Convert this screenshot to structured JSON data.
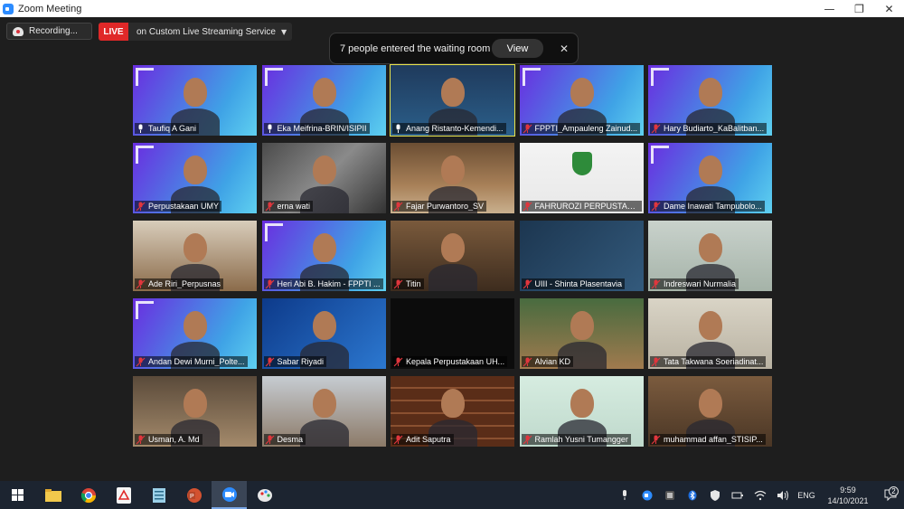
{
  "window": {
    "title": "Zoom Meeting"
  },
  "toolbar": {
    "recording_label": "Recording...",
    "live_badge": "LIVE",
    "live_service": "on Custom Live Streaming Service"
  },
  "waiting_room": {
    "message": "7 people entered the waiting room",
    "view_label": "View"
  },
  "participants": [
    {
      "name": "Taufiq  A Gani",
      "muted": false,
      "bg": "semi"
    },
    {
      "name": "Eka Meifrina-BRIN/ISIPII",
      "muted": false,
      "bg": "semi"
    },
    {
      "name": "Anang Ristanto-Kemendi...",
      "muted": false,
      "bg": "slide",
      "active": true
    },
    {
      "name": "FPPTI_Ampauleng Zainud...",
      "muted": true,
      "bg": "semi"
    },
    {
      "name": "Hary Budiarto_KaBalitban...",
      "muted": true,
      "bg": "semi"
    },
    {
      "name": "Perpustakaan UMY",
      "muted": true,
      "bg": "semi"
    },
    {
      "name": "erna wati",
      "muted": true,
      "bg": "room"
    },
    {
      "name": "Fajar Purwantoro_SV",
      "muted": true,
      "bg": "library"
    },
    {
      "name": "FAHRUROZI PERPUSTAKA...",
      "muted": true,
      "bg": "walisongo"
    },
    {
      "name": "Dame Inawati Tampubolo...",
      "muted": true,
      "bg": "semi"
    },
    {
      "name": "Ade Riri_Perpusnas",
      "muted": true,
      "bg": "house"
    },
    {
      "name": "Heri Abi B. Hakim - FPPTI ...",
      "muted": true,
      "bg": "semi"
    },
    {
      "name": "Titin",
      "muted": true,
      "bg": "kitchen"
    },
    {
      "name": "UIII - Shinta Plasentavia",
      "muted": true,
      "bg": "uiii"
    },
    {
      "name": "Indreswari Nurmalia",
      "muted": true,
      "bg": "office"
    },
    {
      "name": "Andan Dewi Murni_Polte...",
      "muted": true,
      "bg": "semi"
    },
    {
      "name": "Sabar Riyadi",
      "muted": true,
      "bg": "blue"
    },
    {
      "name": "Kepala Perpustakaan UH...",
      "muted": true,
      "bg": "black"
    },
    {
      "name": "Alvian KD",
      "muted": true,
      "bg": "library2"
    },
    {
      "name": "Tata Takwana Soeriadinat...",
      "muted": true,
      "bg": "wall"
    },
    {
      "name": "Usman, A. Md",
      "muted": true,
      "bg": "shop"
    },
    {
      "name": "Desma",
      "muted": true,
      "bg": "outdoor"
    },
    {
      "name": "Adit Saputra",
      "muted": true,
      "bg": "shelves"
    },
    {
      "name": "Ramlah Yusni Tumangger",
      "muted": true,
      "bg": "plain"
    },
    {
      "name": "muhammad affan_STISIP...",
      "muted": true,
      "bg": "study"
    }
  ],
  "taskbar": {
    "apps": [
      "windows-start",
      "file-explorer",
      "chrome",
      "acrobat",
      "notepad",
      "powerpoint",
      "zoom",
      "paint"
    ],
    "language": "ENG",
    "time": "9:59",
    "date": "14/10/2021",
    "notification_count": "2"
  },
  "colors": {
    "live_red": "#e02828",
    "active_speaker": "#e8e34a",
    "muted_red": "#e0363d"
  }
}
